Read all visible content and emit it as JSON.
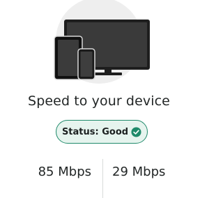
{
  "device_illustration": {
    "icon": "devices-icon",
    "label": ""
  },
  "title": "Speed to your device",
  "status": {
    "label": "Status: Good",
    "icon": "check-circle-icon",
    "color": "#1f8a6a"
  },
  "speeds": {
    "download": "85 Mbps",
    "upload": "29 Mbps"
  }
}
